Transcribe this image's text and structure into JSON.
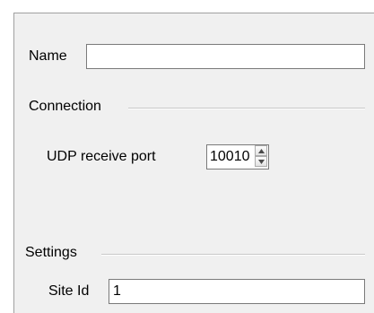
{
  "form": {
    "name_label": "Name",
    "name_value": "",
    "connection": {
      "title": "Connection",
      "udp_port_label": "UDP receive port",
      "udp_port_value": "10010"
    },
    "settings": {
      "title": "Settings",
      "site_id_label": "Site Id",
      "site_id_value": "1"
    }
  },
  "icons": {
    "spin_up": "arrow-up-icon",
    "spin_down": "arrow-down-icon"
  },
  "colors": {
    "panel_bg": "#f0f0f0",
    "input_border": "#7a7a7a",
    "group_line": "#c8c8c8"
  }
}
